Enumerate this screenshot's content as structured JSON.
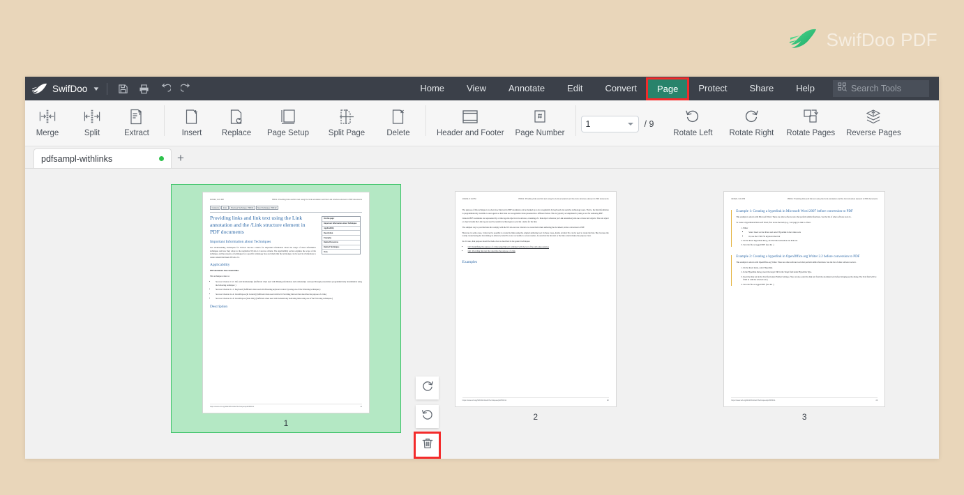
{
  "brand": {
    "name": "SwifDoo PDF",
    "logo_icon": "swift-bird-icon",
    "logo_color": "#3fc77e",
    "desktop_bg": "#e9d6ba"
  },
  "menubar": {
    "app_name": "SwifDoo",
    "app_caret_icon": "chevron-down-icon",
    "quick_actions": [
      {
        "name": "save-icon",
        "label": "Save"
      },
      {
        "name": "print-icon",
        "label": "Print"
      },
      {
        "name": "undo-icon",
        "label": "Undo"
      },
      {
        "name": "redo-icon",
        "label": "Redo"
      }
    ],
    "items": [
      {
        "label": "Home",
        "active": false
      },
      {
        "label": "View",
        "active": false
      },
      {
        "label": "Annotate",
        "active": false
      },
      {
        "label": "Edit",
        "active": false
      },
      {
        "label": "Convert",
        "active": false
      },
      {
        "label": "Page",
        "active": true
      },
      {
        "label": "Protect",
        "active": false
      },
      {
        "label": "Share",
        "active": false
      },
      {
        "label": "Help",
        "active": false
      }
    ],
    "active_tab": "Page",
    "active_tab_bg": "#28836b",
    "highlight_color": "#f32b2b",
    "bar_bg": "#3b4049",
    "search": {
      "placeholder": "Search Tools",
      "icon": "search-tools-icon",
      "value": ""
    }
  },
  "ribbon": {
    "groups": [
      {
        "items": [
          {
            "label": "Merge",
            "icon": "merge-icon"
          },
          {
            "label": "Split",
            "icon": "split-icon"
          },
          {
            "label": "Extract",
            "icon": "extract-icon"
          }
        ]
      },
      {
        "items": [
          {
            "label": "Insert",
            "icon": "insert-page-icon"
          },
          {
            "label": "Replace",
            "icon": "replace-page-icon"
          },
          {
            "label": "Page Setup",
            "icon": "page-setup-icon"
          },
          {
            "label": "Split Page",
            "icon": "split-page-icon"
          },
          {
            "label": "Delete",
            "icon": "delete-page-icon"
          }
        ]
      },
      {
        "items": [
          {
            "label": "Header and Footer",
            "icon": "header-footer-icon"
          },
          {
            "label": "Page Number",
            "icon": "page-number-icon"
          }
        ]
      },
      {
        "items": [
          {
            "label": "Rotate Left",
            "icon": "rotate-left-icon"
          },
          {
            "label": "Rotate Right",
            "icon": "rotate-right-icon"
          },
          {
            "label": "Rotate Pages",
            "icon": "rotate-pages-icon"
          },
          {
            "label": "Reverse Pages",
            "icon": "reverse-pages-icon"
          }
        ]
      }
    ],
    "page_selector": {
      "current_page": "1",
      "total_label": "/ 9",
      "total_pages": 9,
      "caret_icon": "chevron-down-icon"
    }
  },
  "tabstrip": {
    "tabs": [
      {
        "title": "pdfsampl-withlinks",
        "modified": true,
        "dot_color": "#2ec24c"
      }
    ],
    "add_tab_label": "+",
    "add_tab_icon": "plus-icon"
  },
  "workspace": {
    "selection_bg": "#b4e8c4",
    "selection_border": "#3fc46a",
    "page_actions": [
      {
        "name": "rotate-right-button",
        "icon": "rotate-right-icon",
        "flagged": false
      },
      {
        "name": "rotate-left-button",
        "icon": "rotate-left-icon",
        "flagged": false
      },
      {
        "name": "delete-page-button",
        "icon": "trash-icon",
        "flagged": true
      },
      {
        "name": "insert-page-button",
        "icon": "plus-circle-icon",
        "flagged": false
      }
    ],
    "thumbnails": [
      {
        "number": "1",
        "selected": true
      },
      {
        "number": "2",
        "selected": false
      },
      {
        "number": "3",
        "selected": false
      }
    ]
  },
  "document": {
    "header_date": "10/3/22, 3:21 PM",
    "header_title": "PDF11: Providing links and link text using the /Link annotation and the /Link structure element in PDF documents",
    "footer_url": "https://www.w3.org/WAI/WCAG22/Techniques/pdf/PDF11",
    "page1": {
      "crumbs": [
        "Contents",
        "Intro",
        "Previous Technique: PDF10",
        "Next Technique: PDF12"
      ],
      "title": "Providing links and link text using the Link annotation and the /Link structure element in PDF documents",
      "h2_techniques": "Important Information about Techniques",
      "techniques_para": "See Understanding Techniques for WCAG Success Criteria for important information about the usage of these informative techniques and how they relate to the normative WCAG 2.2 success criteria. The Applicability section explains the scope of the technique, and the presence of techniques for a specific technology does not imply that the technology can be used in all situations to create content that meets WCAG 2.2.",
      "techniques_link": "Understanding Techniques for WCAG Success Criteria",
      "h2_applicability": "Applicability",
      "applicability_bold": "PDF documents that contain links.",
      "applicability_lead": "This technique relates to:",
      "applicability_items": [
        "Success Criterion 1.3.1: Info and Relationships (Sufficient when used with Making information and relationships conveyed through presentation programmatically determinable using the following technique: )",
        "Success Criterion 2.1.1: Keyboard (Sufficient when used with Ensuring keyboard control by using one of the following techniques.)",
        "Success Criterion 2.4.4: Link Purpose (In Context) (Sufficient when used with G91: Providing link text that describes the purpose of a link)",
        "Success Criterion 2.4.9: Link Purpose (Link Only) (Sufficient when used with Semantically indicating links using one of the following techniques.)"
      ],
      "h2_description": "Description",
      "sidebar_title": "On this page:",
      "sidebar_items": [
        "Important Information about Techniques",
        "Applicability",
        "Description",
        "Examples",
        "Related Resources",
        "Related Techniques",
        "Tests"
      ],
      "page_label": "11"
    },
    "page2": {
      "paras": [
        "The purpose of this technique is to show how link text in PDF documents can be marked up to be recognizable by keyboard and assistive technology users. That is, the link information is programmatically available to user agents so that links are recognizable when presented in a different format. This is typically accomplished by using a tool for authoring PDF.",
        "Links in PDF documents are represented by a Link tag and objects in its sub-tree, consisting of a link object reference (or Link annotation) and one or more text objects. The text object or objects inside the Link tag are used by assistive technologies to provide a name for the link.",
        "The simplest way to provide links that comply with the WCAG success criteria is to create them when authoring the document, before conversion to PDF.",
        "However, in some cases, it may not be possible to create the links using the original authoring tool. In these cases, Adobe Acrobat Pro can be used to create the link. But, because the tooltip created using the Link dialog in Adobe Acrobat Pro is not accessible to screen readers, be sure that the link text or the link context makes the purpose clear.",
        "In all cases, link purpose should be made clear as described in the general techniques:"
      ],
      "links": [
        "G53: Identifying the purpose of a link using link text combined with the text of the enclosing sentence",
        "G91: Providing link text that describes the purpose of a link"
      ],
      "h2_examples": "Examples",
      "page_label": "28"
    },
    "page3": {
      "example1_title": "Example 1: Creating a hyperlink in Microsoft Word 2007 before conversion to PDF",
      "example1_intro": "This example is shown with Microsoft Word. There are other software tools that perform similar functions. See the list of other software tools in .",
      "example1_lead": "To create a hyperlink in Microsoft Word, first locate the item (e.g., web page) to link to. Then:",
      "example1_steps": [
        "Either",
        "On the Insert Hyperlink dialog, add the link destination and link text.",
        "Save the file as tagged PDF. (See the .)"
      ],
      "example1_substeps": [
        "Select Insert on the ribbon and select Hyperlink in the Links tools",
        "Or, use the CTRL+K keyboard shortcut"
      ],
      "example2_title": "Example 2: Creating a hyperlink in OpenOffice.org Writer 2.2 before conversion to PDF",
      "example2_intro": "This example is shown with OpenOffice.org Writer. There are other software tools that perform similar functions. See the list of other software tools in .",
      "example2_steps": [
        "On the Insert menu, select Hyperlink.",
        "In the Hyperlink dialog, insert the target URI in the Target field under Hyperlink Type.",
        "Insert the link text in the Text field under Further Settings. (You can also select the link text from the document text before bringing up the dialog. The Text field will be filled in with the selected text.)",
        "Save the file as tagged PDF. (See the .)"
      ],
      "page_label": "29"
    }
  }
}
